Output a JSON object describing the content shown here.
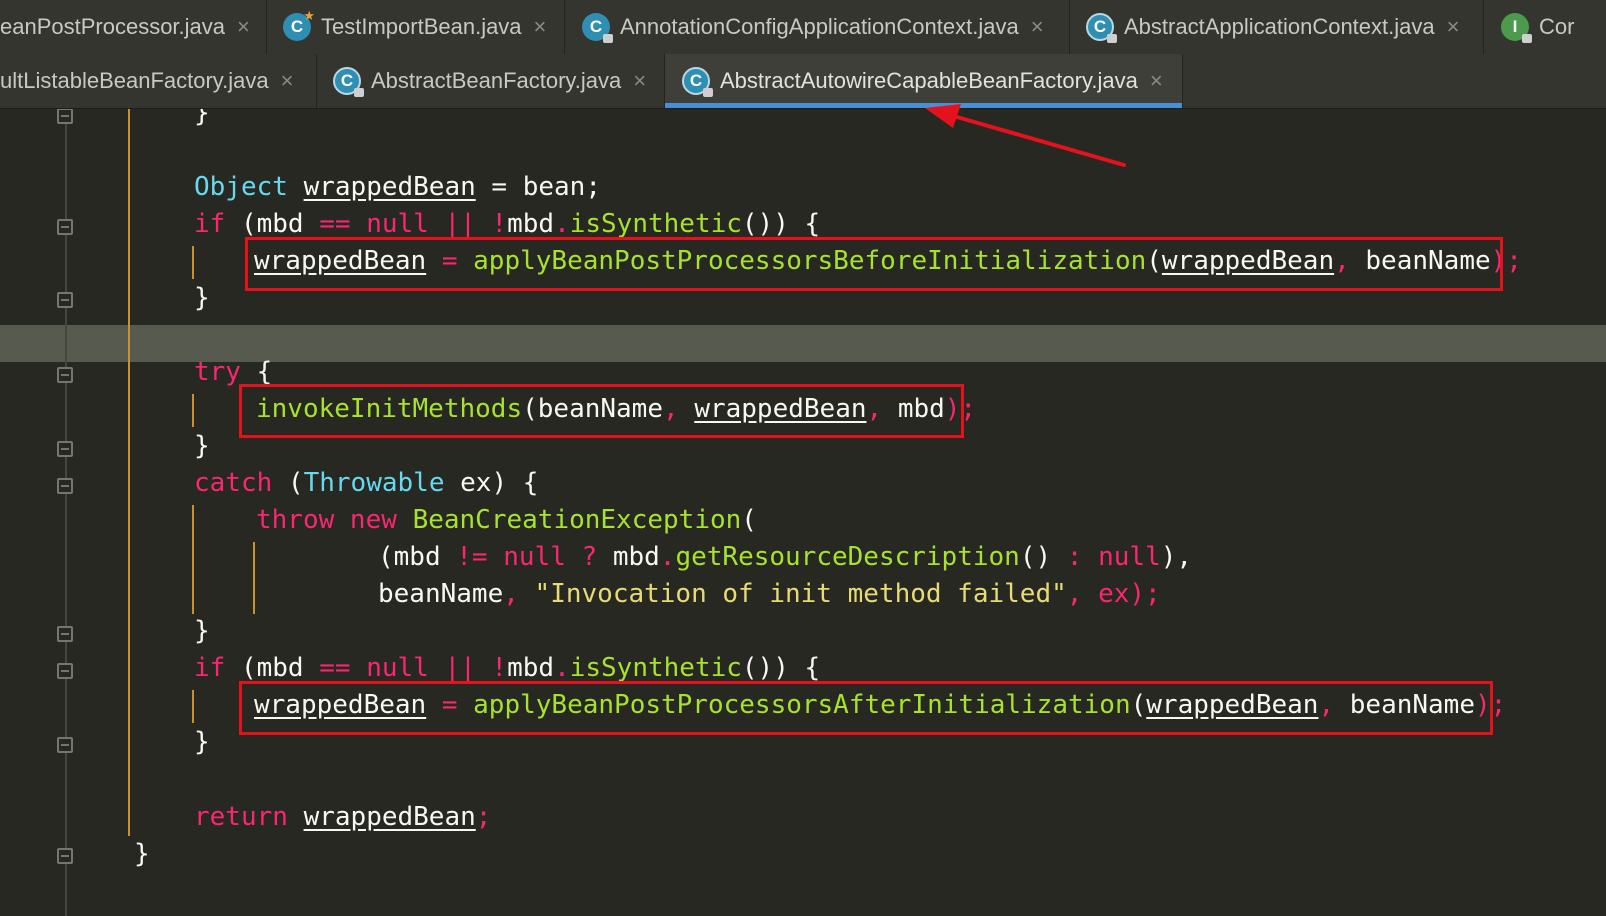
{
  "tabs_row1": [
    {
      "label": "eanPostProcessor.java",
      "icon": "none"
    },
    {
      "label": "TestImportBean.java",
      "icon": "class-icon"
    },
    {
      "label": "AnnotationConfigApplicationContext.java",
      "icon": "class-icon"
    },
    {
      "label": "AbstractApplicationContext.java",
      "icon": "abstract-class-icon"
    },
    {
      "label": "Cor",
      "icon": "interface-icon"
    }
  ],
  "tabs_row2": [
    {
      "label": "ultListableBeanFactory.java",
      "icon": "none"
    },
    {
      "label": "AbstractBeanFactory.java",
      "icon": "abstract-class-icon"
    },
    {
      "label": "AbstractAutowireCapableBeanFactory.java",
      "icon": "abstract-class-icon",
      "active": true
    }
  ],
  "tab_close_glyph": "×",
  "icon_letters": {
    "class": "C",
    "interface": "I"
  },
  "code": {
    "l1": {
      "brace": "}"
    },
    "l2": {
      "type": "Object",
      "var": "wrappedBean",
      "rest": " = bean;"
    },
    "l3": {
      "kw": "if",
      "rest_a": " (mbd ",
      "op1": "==",
      "nul": " null ",
      "op2": "||",
      "bang": " !",
      "obj": "mbd",
      "dot": ".",
      "fn": "isSynthetic",
      "tail": "()) {"
    },
    "l4": {
      "var": "wrappedBean",
      "eq": " = ",
      "fn": "applyBeanPostProcessorsBeforeInitialization",
      "open": "(",
      "arg1": "wrappedBean",
      "comma": ", ",
      "arg2": "beanName",
      "close": ");"
    },
    "l5": {
      "brace": "}"
    },
    "l7": {
      "kw": "try",
      "rest": " {"
    },
    "l8": {
      "fn": "invokeInitMethods",
      "open": "(",
      "arg1": "beanName",
      "comma1": ", ",
      "arg2": "wrappedBean",
      "comma2": ", ",
      "arg3": "mbd",
      "close": ");"
    },
    "l9": {
      "brace": "}"
    },
    "l10": {
      "kw": "catch",
      "open": " (",
      "type": "Throwable",
      "rest": " ex) {"
    },
    "l11": {
      "kw1": "throw",
      "kw2": " new ",
      "fn": "BeanCreationException",
      "rest": "("
    },
    "l12": {
      "open": "(mbd ",
      "op": "!=",
      "nul1": " null ",
      "q": "?",
      "obj": " mbd",
      "dot": ".",
      "fn": "getResourceDescription",
      "mid": "() ",
      "colon": ":",
      "nul2": " null",
      "close": "),"
    },
    "l13": {
      "param": "beanName",
      "comma": ", ",
      "str": "\"Invocation of init method failed\"",
      "rest": ", ex);"
    },
    "l14": {
      "brace": "}"
    },
    "l15": {
      "kw": "if",
      "rest_a": " (mbd ",
      "op1": "==",
      "nul": " null ",
      "op2": "||",
      "bang": " !",
      "obj": "mbd",
      "dot": ".",
      "fn": "isSynthetic",
      "tail": "()) {"
    },
    "l16": {
      "var": "wrappedBean",
      "eq": " = ",
      "fn": "applyBeanPostProcessorsAfterInitialization",
      "open": "(",
      "arg1": "wrappedBean",
      "comma": ", ",
      "arg2": "beanName",
      "close": ");"
    },
    "l17": {
      "brace": "}"
    },
    "l19": {
      "kw": "return",
      "sp": " ",
      "var": "wrappedBean",
      "semi": ";"
    },
    "l20": {
      "brace": "}"
    }
  },
  "colors": {
    "editor_bg": "#272822",
    "keyword": "#f92672",
    "type": "#66d9ef",
    "function": "#a6e22e",
    "string": "#e6db74",
    "annotation_red": "#e4121d",
    "active_tab_underline": "#4a8fd6"
  }
}
